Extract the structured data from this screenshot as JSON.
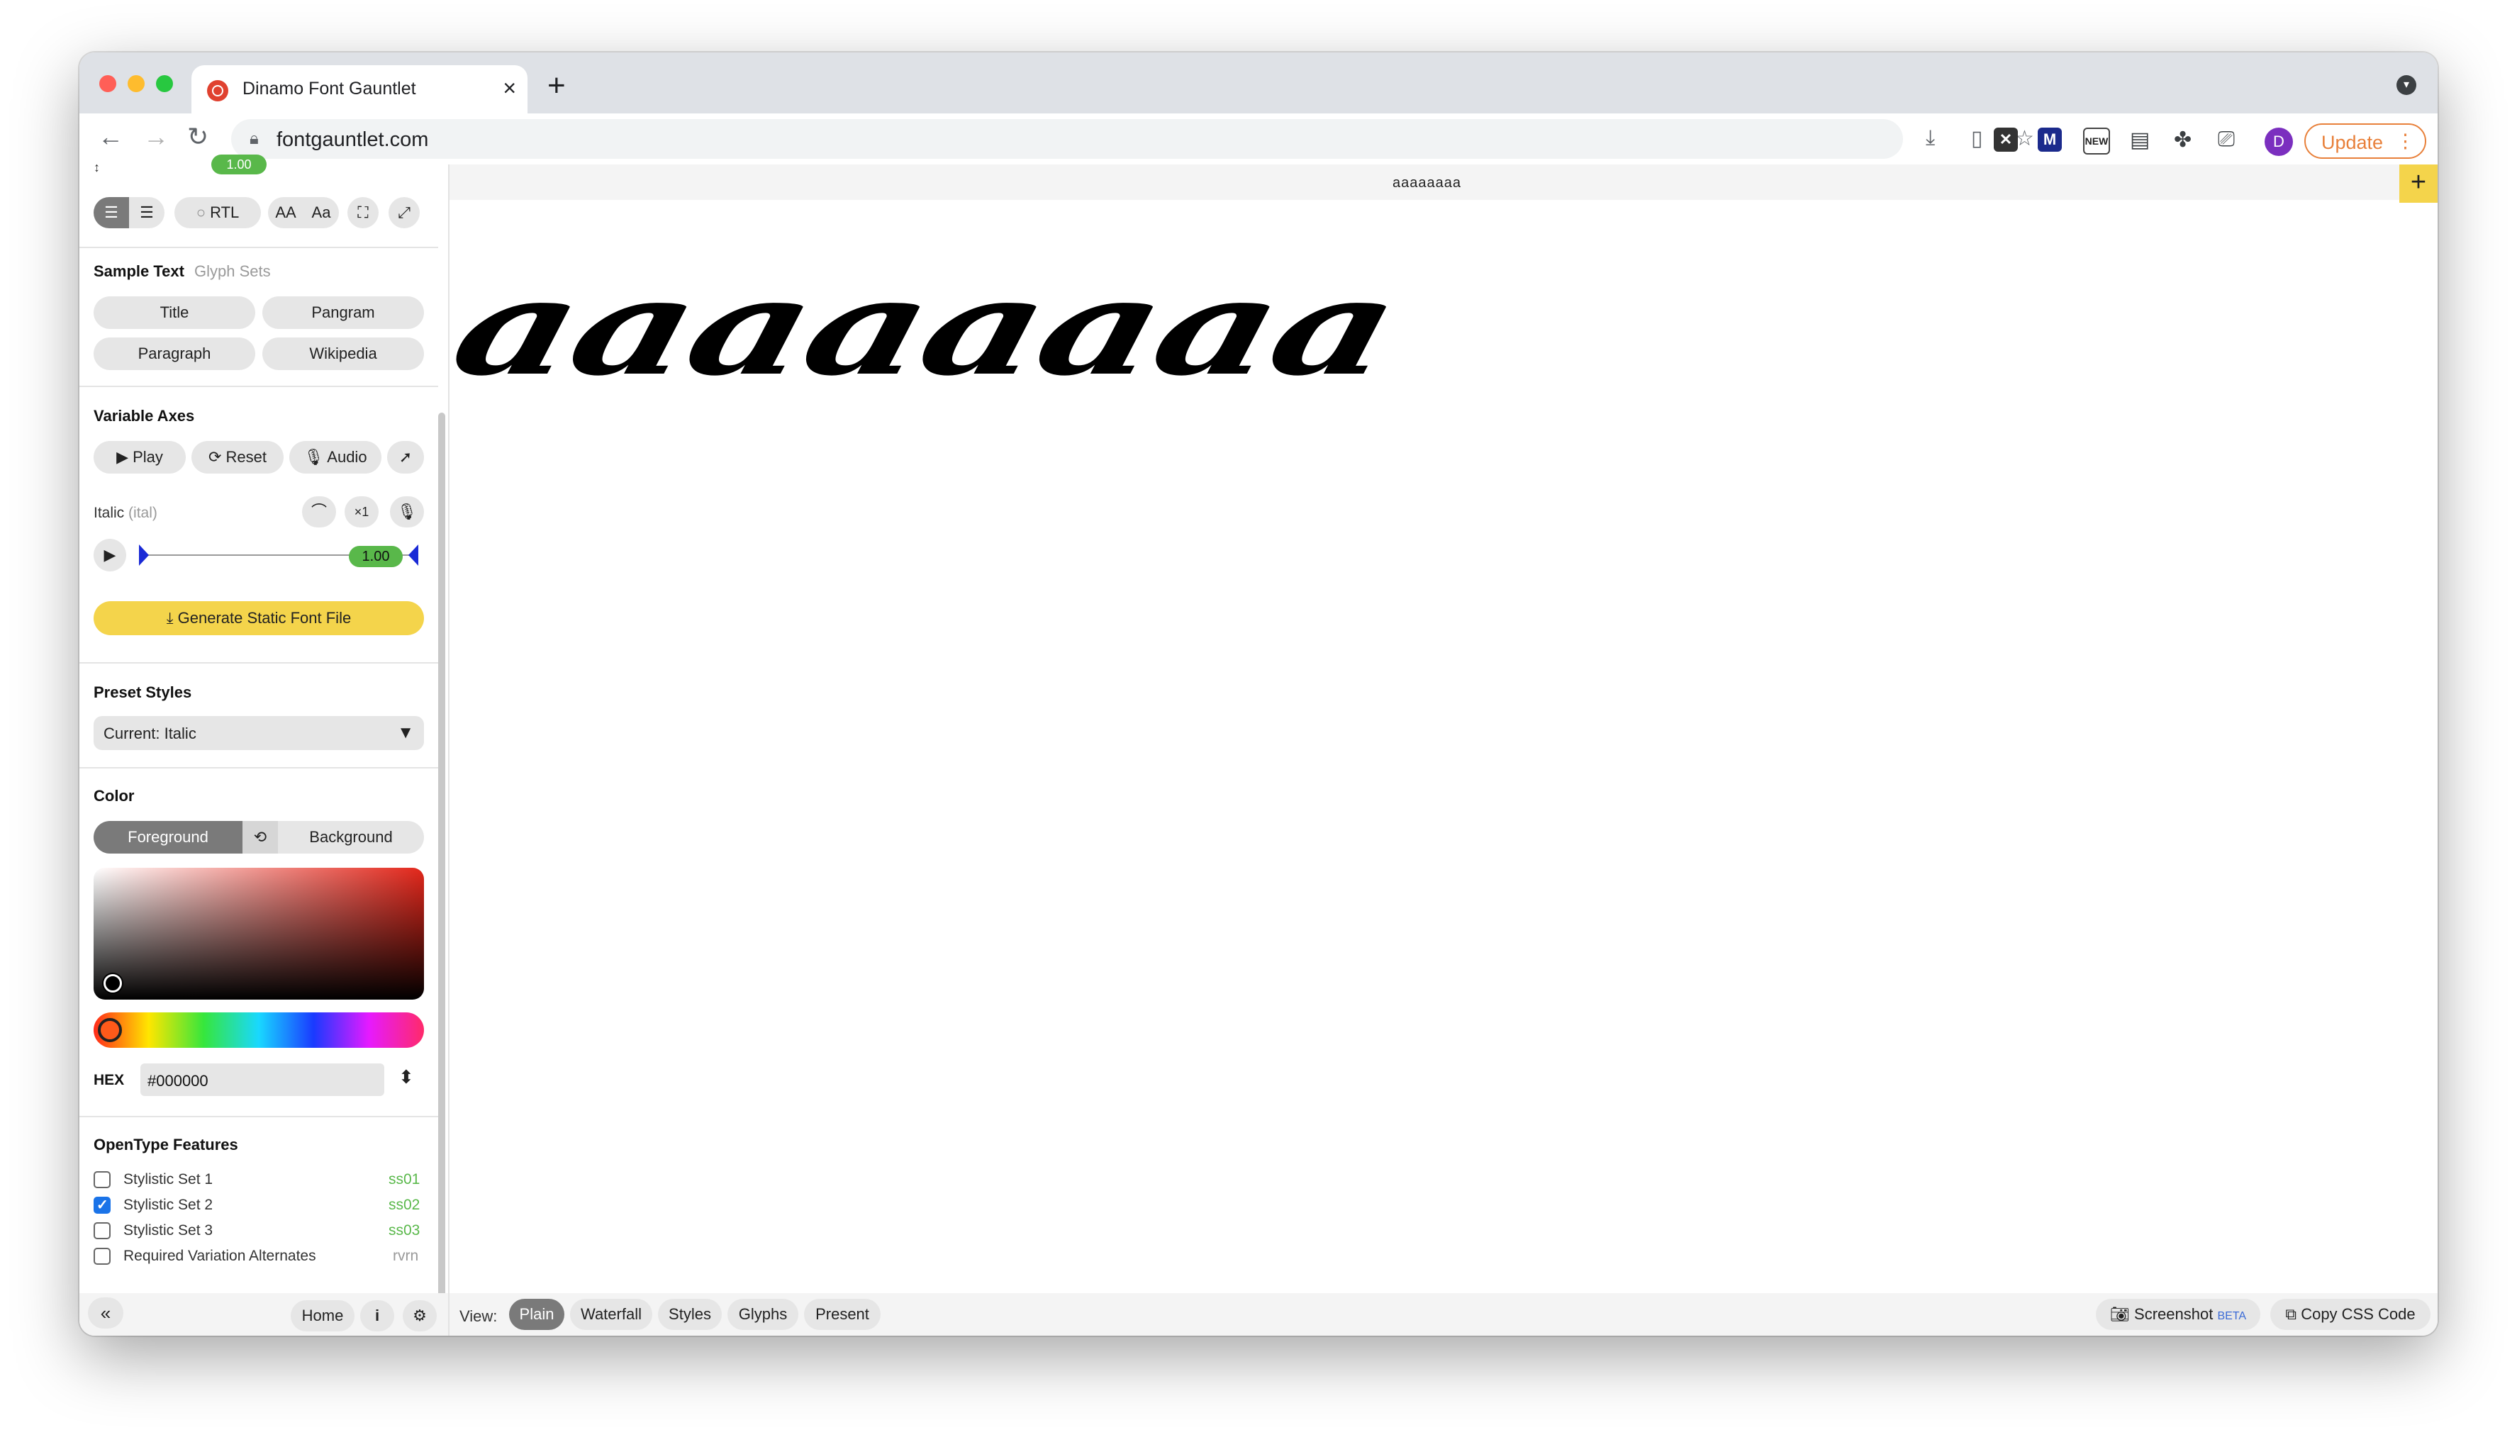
{
  "browser": {
    "tab_title": "Dinamo Font Gauntlet",
    "url": "fontgauntlet.com",
    "update_label": "Update",
    "profile_initial": "D"
  },
  "sidebar": {
    "top_value": "1.00",
    "rtl_label": "RTL",
    "case_upper": "AA",
    "case_mixed": "Aa",
    "sample_text_heading": "Sample Text",
    "glyph_sets_label": "Glyph Sets",
    "samples": [
      "Title",
      "Pangram",
      "Paragraph",
      "Wikipedia"
    ],
    "variable_axes_heading": "Variable Axes",
    "play_label": "Play",
    "reset_label": "Reset",
    "audio_label": "Audio",
    "axis_name": "Italic",
    "axis_tag": "(ital)",
    "axis_multiplier": "×1",
    "axis_value": "1.00",
    "axis_level": 1.0,
    "generate_label": "Generate Static Font File",
    "preset_heading": "Preset Styles",
    "preset_value": "Current: Italic",
    "color_heading": "Color",
    "foreground_label": "Foreground",
    "background_label": "Background",
    "hex_label": "HEX",
    "hex_value": "#000000",
    "opentype_heading": "OpenType Features",
    "features": [
      {
        "label": "Stylistic Set 1",
        "tag": "ss01",
        "checked": false
      },
      {
        "label": "Stylistic Set 2",
        "tag": "ss02",
        "checked": true
      },
      {
        "label": "Stylistic Set 3",
        "tag": "ss03",
        "checked": false
      },
      {
        "label": "Required Variation Alternates",
        "tag": "rvrn",
        "checked": false
      }
    ],
    "home_label": "Home",
    "info_label": "i"
  },
  "content": {
    "top_label": "aaaaaaaa",
    "sample_text": "aaaaaaaa"
  },
  "bottom": {
    "view_label": "View:",
    "views": [
      "Plain",
      "Waterfall",
      "Styles",
      "Glyphs",
      "Present"
    ],
    "active_view": "Plain",
    "screenshot_label": "Screenshot",
    "beta_label": "BETA",
    "copy_css_label": "Copy CSS Code"
  },
  "colors": {
    "accent_green": "#59b84a",
    "accent_yellow": "#f4d44b",
    "picked_color": "#000000"
  }
}
